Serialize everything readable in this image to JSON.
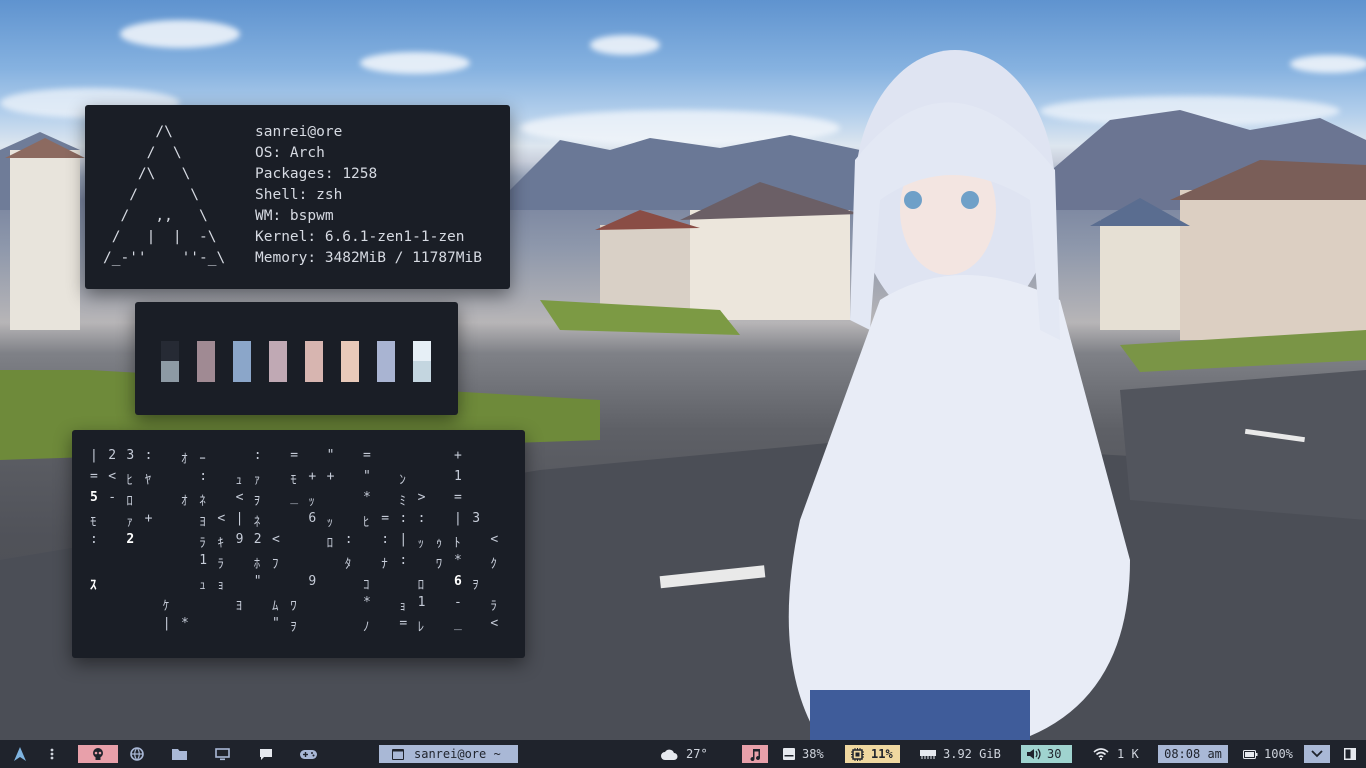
{
  "neofetch": {
    "logo": "      /\\\n     /  \\\n    /\\   \\\n   /      \\\n  /   ,,   \\\n /   |  |  -\\\n/_-''    ''-_\\",
    "user_host": "sanrei@ore",
    "os_label": "OS: ",
    "os": "Arch",
    "packages_label": "Packages: ",
    "packages": "1258",
    "shell_label": "Shell: ",
    "shell": "zsh",
    "wm_label": "WM: ",
    "wm": "bspwm",
    "kernel_label": "Kernel: ",
    "kernel": "6.6.1-zen1-1-zen",
    "memory_label": "Memory: ",
    "memory": "3482MiB / 11787MiB"
  },
  "palette": {
    "top": [
      "#262a34",
      "#a08a93",
      "#8ba6c9",
      "#c0a9b4",
      "#d7b5b0",
      "#e8c9b9",
      "#a9b4d2",
      "#e6eff6"
    ],
    "bottom": [
      "#8d9aa4",
      "#a08a93",
      "#8ba6c9",
      "#c0a9b4",
      "#d7b5b0",
      "#e8c9b9",
      "#a9b4d2",
      "#c4d6e0"
    ]
  },
  "matrix_rows": [
    [
      "|",
      "2",
      "3",
      ":",
      "",
      "ｵ",
      "ｰ",
      "",
      "",
      ":",
      "",
      "=",
      "",
      "\"",
      "",
      "=",
      "",
      "",
      "",
      "",
      "+"
    ],
    [
      "=",
      "<",
      "ﾋ",
      "ﾔ",
      "",
      "",
      ":",
      "",
      "ｭ",
      "ｧ",
      "",
      "ﾓ",
      "+",
      "+",
      "",
      "\"",
      "",
      "ﾝ",
      "",
      "",
      "1"
    ],
    [
      "5",
      "-",
      "ﾛ",
      "",
      "",
      "ｵ",
      "ﾈ",
      "",
      "<",
      "ｦ",
      "",
      "_",
      "ｯ",
      "",
      "",
      "*",
      "",
      "ﾐ",
      ">",
      "",
      "="
    ],
    [
      "ﾓ",
      "",
      "ｧ",
      "+",
      "",
      "",
      "ﾖ",
      "<",
      "|",
      "ﾈ",
      "",
      "",
      "6",
      "ｯ",
      "",
      "ﾋ",
      "=",
      ":",
      ":",
      "",
      "|",
      "3"
    ],
    [
      ":",
      "",
      "2",
      "",
      "",
      "",
      "ﾗ",
      "ｷ",
      "9",
      "2",
      "<",
      "",
      "",
      "ﾛ",
      ":",
      "",
      ":",
      "|",
      "ｯ",
      "ｩ",
      "ﾄ",
      "",
      "<"
    ],
    [
      "",
      "",
      "",
      "",
      "",
      "",
      "1",
      "ﾗ",
      "",
      "ﾎ",
      "ﾌ",
      "",
      "",
      "",
      "ﾀ",
      "",
      "ﾅ",
      ":",
      "",
      "ﾜ",
      "*",
      "",
      "ｸ"
    ],
    [
      "ｽ",
      "",
      "",
      "",
      "",
      "",
      "ｭ",
      "ｮ",
      "",
      "\"",
      "",
      "",
      "9",
      "",
      "",
      "ｺ",
      "",
      "",
      "ﾛ",
      "",
      "6",
      "ｦ"
    ],
    [
      "",
      "",
      "",
      "",
      "ｹ",
      "",
      "",
      "",
      "ﾖ",
      "",
      "ﾑ",
      "ﾜ",
      "",
      "",
      "",
      "*",
      "",
      "ｮ",
      "1",
      "",
      "-",
      "",
      "ﾗ"
    ],
    [
      "",
      "",
      "",
      "",
      "|",
      "*",
      "",
      "",
      "",
      "",
      "\"",
      "ｦ",
      "",
      "",
      "",
      "ﾉ",
      "",
      "=",
      "ﾚ",
      "",
      "_",
      "",
      "<"
    ]
  ],
  "bar": {
    "workspaces": [
      "arch-icon",
      "more-icon",
      "skull-icon",
      "globe-icon",
      "folder-icon",
      "monitor-icon",
      "chat-icon",
      "gamepad-icon"
    ],
    "active_window": "sanrei@ore ~",
    "weather": "27°",
    "disk": "38%",
    "cpu": "11%",
    "ram": "3.92 GiB",
    "volume": "30",
    "network": "1 K",
    "clock": "08:08 am",
    "battery": "100%",
    "colors": {
      "pink": "#e8a0aa",
      "blue": "#a9b8d6",
      "yellow": "#f0d8a0",
      "teal": "#9fd3cf",
      "bg": "#1f232c"
    }
  }
}
